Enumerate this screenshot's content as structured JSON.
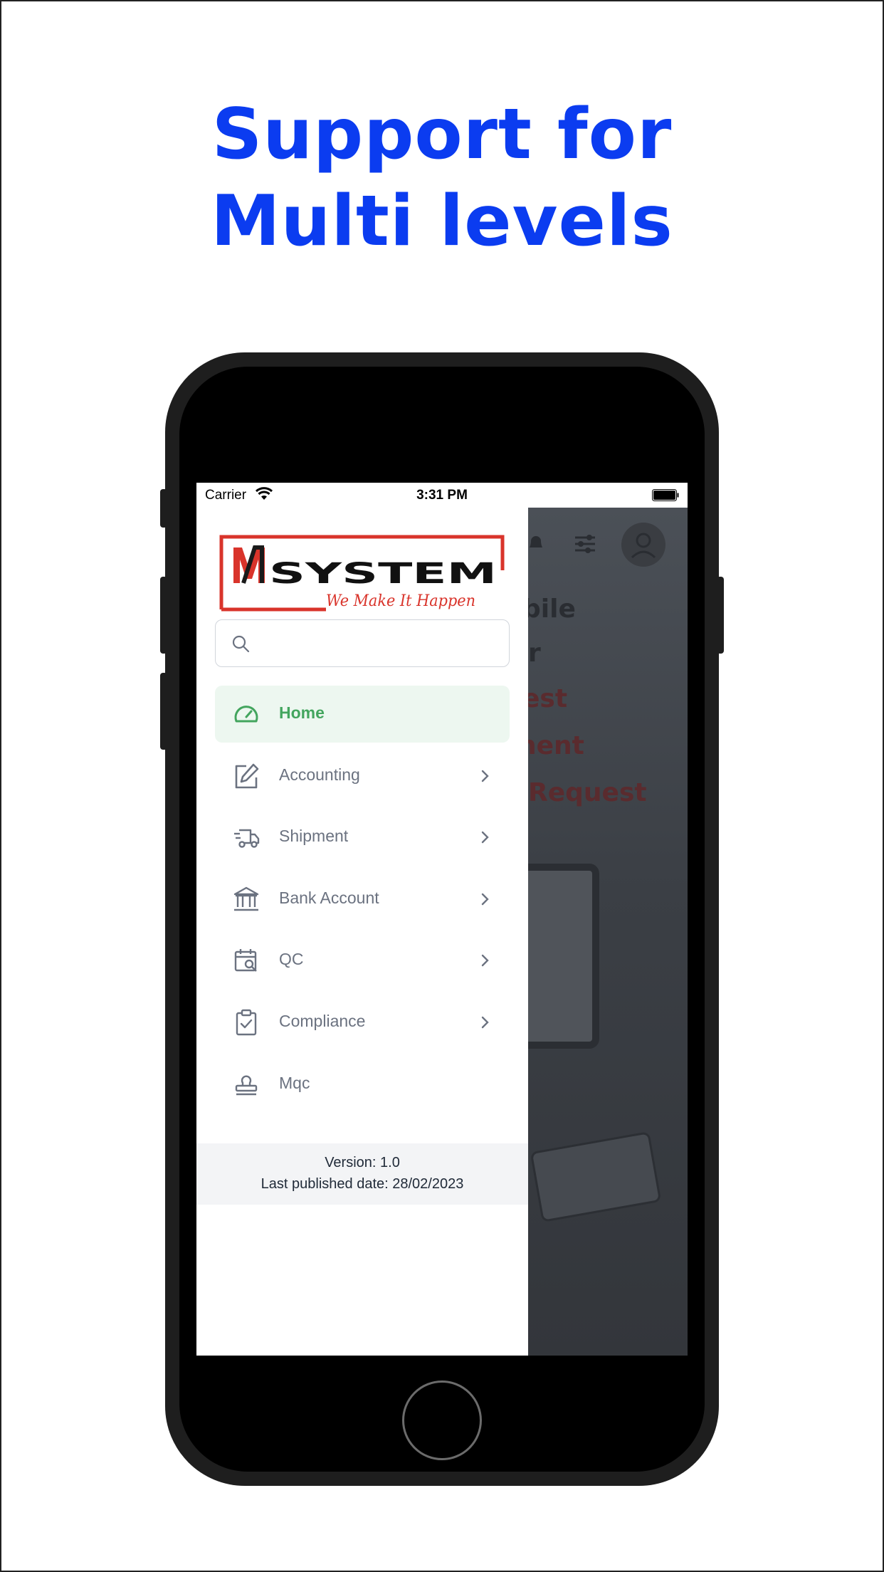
{
  "headline": {
    "line1": "Support for",
    "line2": "Multi levels"
  },
  "statusbar": {
    "carrier": "Carrier",
    "time": "3:31 PM"
  },
  "logo": {
    "brand": "SYSTEM",
    "letter": "M",
    "tagline": "We Make It Happen"
  },
  "search": {
    "placeholder": "",
    "value": ""
  },
  "menu": [
    {
      "label": "Home",
      "icon": "speedometer-icon",
      "active": true,
      "has_submenu": false
    },
    {
      "label": "Accounting",
      "icon": "edit-icon",
      "active": false,
      "has_submenu": true
    },
    {
      "label": "Shipment",
      "icon": "truck-icon",
      "active": false,
      "has_submenu": true
    },
    {
      "label": "Bank Account",
      "icon": "bank-icon",
      "active": false,
      "has_submenu": true
    },
    {
      "label": "QC",
      "icon": "calendar-search-icon",
      "active": false,
      "has_submenu": true
    },
    {
      "label": "Compliance",
      "icon": "clipboard-check-icon",
      "active": false,
      "has_submenu": true
    },
    {
      "label": "Mqc",
      "icon": "stamp-icon",
      "active": false,
      "has_submenu": false
    }
  ],
  "footer": {
    "version": "Version: 1.0",
    "published": "Last published date: 28/02/2023"
  },
  "background": {
    "lines": [
      "bile",
      "r",
      "est",
      "nent",
      "Request"
    ]
  },
  "colors": {
    "headline": "#0b3cf0",
    "active_green": "#43a55e",
    "active_bg": "#edf7f0",
    "logo_red": "#d9342b"
  }
}
